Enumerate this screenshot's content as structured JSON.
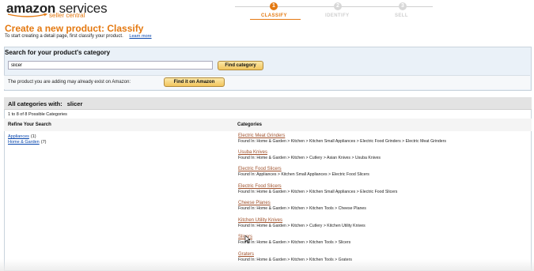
{
  "header": {
    "logo_main": "amazon",
    "logo_rest": " services",
    "logo_sub": "seller central",
    "steps": [
      {
        "num": "1",
        "label": "CLASSIFY"
      },
      {
        "num": "2",
        "label": "IDENTIFY"
      },
      {
        "num": "3",
        "label": "SELL"
      }
    ]
  },
  "page": {
    "title": "Create a new product: Classify",
    "subtitle": "To start creating a detail page, first classify your product.",
    "learn_more": "Learn more"
  },
  "search": {
    "heading": "Search for your product's category",
    "query": "slicer",
    "button": "Find category",
    "exists_text": "The product you are adding may already exist on Amazon:",
    "exists_button": "Find it on Amazon"
  },
  "results": {
    "heading": "All categories with:",
    "keyword": "slicer",
    "count_text": "1 to 8 of 8 Possible Categories",
    "refine_heading": "Refine Your Search",
    "categories_heading": "Categories",
    "refine": [
      {
        "label": "Appliances",
        "count": "(1)"
      },
      {
        "label": "Home & Garden",
        "count": "(7)"
      }
    ],
    "categories": [
      {
        "title": "Electric Meat Grinders",
        "path": "Found In: Home & Garden > Kitchen > Kitchen Small Appliances > Electric Food Grinders > Electric Meat Grinders"
      },
      {
        "title": "Usuba Knives",
        "path": "Found In: Home & Garden > Kitchen > Cutlery > Asian Knives > Usuba Knives"
      },
      {
        "title": "Electric Food Slicers",
        "path": "Found In: Appliances > Kitchen Small Appliances > Electric Food Slicers"
      },
      {
        "title": "Electric Food Slicers",
        "path": "Found In: Home & Garden > Kitchen > Kitchen Small Appliances > Electric Food Slicers"
      },
      {
        "title": "Cheese Planes",
        "path": "Found In: Home & Garden > Kitchen > Kitchen Tools > Cheese Planes"
      },
      {
        "title": "Kitchen Utility Knives",
        "path": "Found In: Home & Garden > Kitchen > Cutlery > Kitchen Utility Knives"
      },
      {
        "title": "Slicers",
        "path": "Found In: Home & Garden > Kitchen > Kitchen Tools > Slicers"
      },
      {
        "title": "Graters",
        "path": "Found In: Home & Garden > Kitchen > Kitchen Tools > Graters"
      }
    ]
  },
  "colors": {
    "accent": "#e47911",
    "link": "#0645ad",
    "category_link": "#a0522d",
    "panel_bg": "#eaf1f8"
  }
}
